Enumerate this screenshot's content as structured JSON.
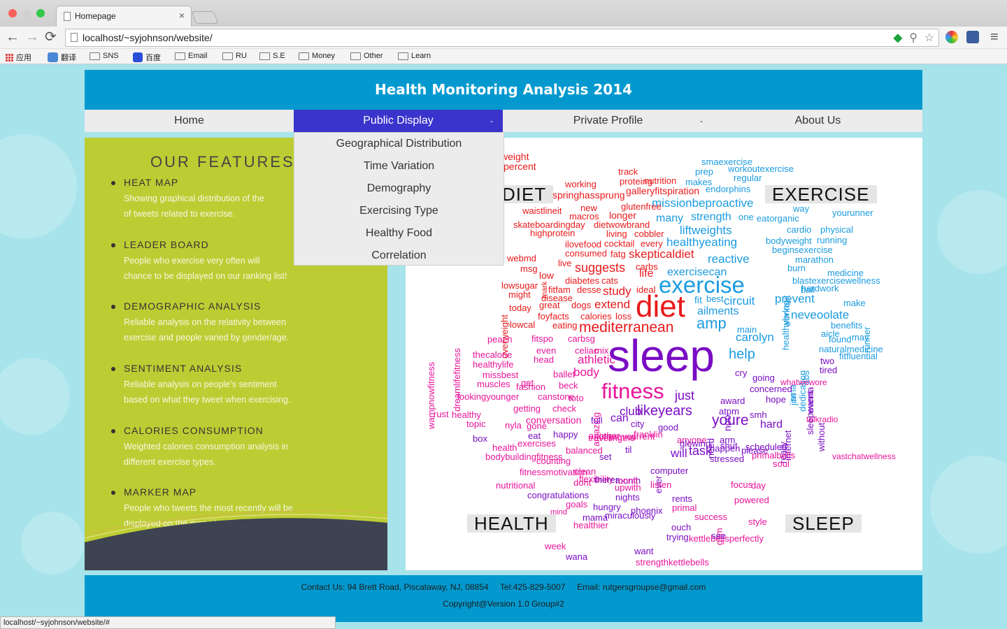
{
  "browser": {
    "tab_title": "Homepage",
    "tab_close": "×",
    "url": "localhost/~syjohnson/website/",
    "back": "←",
    "forward": "→",
    "reload": "⟳",
    "menu": "≡",
    "bookmarks": [
      "应用",
      "翻译",
      "SNS",
      "百度",
      "Email",
      "RU",
      "S.E",
      "Money",
      "Other",
      "Learn"
    ]
  },
  "site": {
    "title": "Health Monitoring Analysis 2014",
    "nav": [
      {
        "label": "Home"
      },
      {
        "label": "Public Display",
        "dash": "-"
      },
      {
        "label": "Private Profile",
        "dash": "-"
      },
      {
        "label": "About Us"
      }
    ],
    "dropdown": [
      "Geographical Distribution",
      "Time Variation",
      "Demography",
      "Exercising Type",
      "Healthy Food",
      "Correlation"
    ],
    "features_title": "OUR FEATURES",
    "features": [
      {
        "heading": "HEAT MAP",
        "lines": [
          "Showing graphical distribution of the",
          "of tweets related to exercise."
        ]
      },
      {
        "heading": "LEADER BOARD",
        "lines": [
          "People who exercise very often will",
          "chance to be displayed on our ranking list!"
        ]
      },
      {
        "heading": "DEMOGRAPHIC ANALYSIS",
        "lines": [
          "Reliable analysis on the relativity between",
          "exercise and people varied by gender/age."
        ]
      },
      {
        "heading": "SENTIMENT ANALYSIS",
        "lines": [
          "Reliable analysis on people’s sentiment",
          "based on what they tweet when exercising."
        ]
      },
      {
        "heading": "CALORIES CONSUMPTION",
        "lines": [
          "Weighted calories consumption analysis in",
          "different exercise types."
        ]
      },
      {
        "heading": "MARKER MAP",
        "lines": [
          "People who tweets the most recently will be",
          "displayed on the map identified by a marker."
        ]
      }
    ],
    "corner_labels": {
      "diet": "DIET",
      "exercise": "EXERCISE",
      "health": "HEALTH",
      "sleep": "SLEEP"
    },
    "footer": {
      "line1": "Contact Us: 94 Brett Road, Piscataway, NJ, 08854     Tel:425-829-5007     Email: rutgersgroupse@gmail.com",
      "line2": "Copyright@Version 1.0 Group#2"
    }
  },
  "status_bar": "localhost/~syjohnson/website/#",
  "colors": {
    "banner": "#0399cf",
    "nav_active": "#3a34cc",
    "features_bg": "#bccd34",
    "page_bg": "#a7e3ea",
    "diet_red": "#e8191b",
    "exercise_blue": "#1b9be0",
    "sleep_purple": "#7a0cc4",
    "health_pink": "#e8149a"
  },
  "wordcloud": [
    {
      "t": "weight",
      "c": "#e8191b"
    },
    {
      "t": "percent",
      "c": "#e8191b"
    },
    {
      "t": "smaexercise",
      "c": "#1b9be0"
    },
    {
      "t": "prep",
      "c": "#1b9be0"
    },
    {
      "t": "workoutexercise",
      "c": "#1b9be0"
    },
    {
      "t": "track",
      "c": "#e8191b"
    },
    {
      "t": "proteing",
      "c": "#e8191b"
    },
    {
      "t": "nutrition",
      "c": "#e8191b"
    },
    {
      "t": "makes",
      "c": "#1b9be0"
    },
    {
      "t": "regular",
      "c": "#1b9be0"
    },
    {
      "t": "working",
      "c": "#e8191b"
    },
    {
      "t": "springhassprung",
      "c": "#e8191b"
    },
    {
      "t": "galleryfitspiration",
      "c": "#e8191b"
    },
    {
      "t": "endorphins",
      "c": "#1b9be0"
    },
    {
      "t": "missionbeproactive",
      "c": "#1b9be0"
    },
    {
      "t": "way",
      "c": "#1b9be0"
    },
    {
      "t": "yourunner",
      "c": "#1b9be0"
    },
    {
      "t": "waistlineit",
      "c": "#e8191b"
    },
    {
      "t": "new",
      "c": "#e8191b"
    },
    {
      "t": "glutenfree",
      "c": "#e8191b"
    },
    {
      "t": "macros",
      "c": "#e8191b"
    },
    {
      "t": "longer",
      "c": "#e8191b"
    },
    {
      "t": "many",
      "c": "#1b9be0"
    },
    {
      "t": "strength",
      "c": "#1b9be0"
    },
    {
      "t": "one",
      "c": "#1b9be0"
    },
    {
      "t": "eatorganic",
      "c": "#1b9be0"
    },
    {
      "t": "skateboardingday",
      "c": "#e8191b"
    },
    {
      "t": "dietwowbrand",
      "c": "#e8191b"
    },
    {
      "t": "liftweights",
      "c": "#1b9be0"
    },
    {
      "t": "cardio",
      "c": "#1b9be0"
    },
    {
      "t": "physical",
      "c": "#1b9be0"
    },
    {
      "t": "highprotein",
      "c": "#e8191b"
    },
    {
      "t": "living",
      "c": "#e8191b"
    },
    {
      "t": "cobbler",
      "c": "#e8191b"
    },
    {
      "t": "healthyeating",
      "c": "#1b9be0"
    },
    {
      "t": "bodyweight",
      "c": "#1b9be0"
    },
    {
      "t": "running",
      "c": "#1b9be0"
    },
    {
      "t": "ilovefood",
      "c": "#e8191b"
    },
    {
      "t": "cocktail",
      "c": "#e8191b"
    },
    {
      "t": "every",
      "c": "#e8191b"
    },
    {
      "t": "beginsexercise",
      "c": "#1b9be0"
    },
    {
      "t": "webmd",
      "c": "#e8191b"
    },
    {
      "t": "mark",
      "c": "#e8191b"
    },
    {
      "t": "consumed",
      "c": "#e8191b"
    },
    {
      "t": "fatg",
      "c": "#e8191b"
    },
    {
      "t": "skepticaldiet",
      "c": "#e8191b"
    },
    {
      "t": "reactive",
      "c": "#1b9be0"
    },
    {
      "t": "marathon",
      "c": "#1b9be0"
    },
    {
      "t": "msg",
      "c": "#e8191b"
    },
    {
      "t": "live",
      "c": "#e8191b"
    },
    {
      "t": "suggests",
      "c": "#e8191b"
    },
    {
      "t": "carbs",
      "c": "#e8191b"
    },
    {
      "t": "exercisecan",
      "c": "#1b9be0"
    },
    {
      "t": "burn",
      "c": "#1b9be0"
    },
    {
      "t": "medicine",
      "c": "#1b9be0"
    },
    {
      "t": "low",
      "c": "#e8191b"
    },
    {
      "t": "life",
      "c": "#e8191b"
    },
    {
      "t": "healthyliving",
      "c": "#1b9be0"
    },
    {
      "t": "workout",
      "c": "#1b9be0"
    },
    {
      "t": "blastexercisewellness",
      "c": "#1b9be0"
    },
    {
      "t": "diabetes",
      "c": "#e8191b"
    },
    {
      "t": "cats",
      "c": "#e8191b"
    },
    {
      "t": "exercise",
      "c": "#1b9be0"
    },
    {
      "t": "lowsugar",
      "c": "#e8191b"
    },
    {
      "t": "fitfam",
      "c": "#e8191b"
    },
    {
      "t": "desse",
      "c": "#e8191b"
    },
    {
      "t": "study",
      "c": "#e8191b"
    },
    {
      "t": "ideal",
      "c": "#e8191b"
    },
    {
      "t": "ball",
      "c": "#1b9be0"
    },
    {
      "t": "hardwork",
      "c": "#1b9be0"
    },
    {
      "t": "might",
      "c": "#e8191b"
    },
    {
      "t": "disease",
      "c": "#e8191b"
    },
    {
      "t": "fit",
      "c": "#1b9be0"
    },
    {
      "t": "best",
      "c": "#1b9be0"
    },
    {
      "t": "circuit",
      "c": "#1b9be0"
    },
    {
      "t": "prevent",
      "c": "#1b9be0"
    },
    {
      "t": "make",
      "c": "#1b9be0"
    },
    {
      "t": "overweight",
      "c": "#e8191b"
    },
    {
      "t": "great",
      "c": "#e8191b"
    },
    {
      "t": "dogs",
      "c": "#e8191b"
    },
    {
      "t": "extend",
      "c": "#e8191b"
    },
    {
      "t": "diet",
      "c": "#e8191b"
    },
    {
      "t": "ailments",
      "c": "#1b9be0"
    },
    {
      "t": "runner",
      "c": "#1b9be0"
    },
    {
      "t": "today",
      "c": "#e8191b"
    },
    {
      "t": "foyfacts",
      "c": "#e8191b"
    },
    {
      "t": "calories",
      "c": "#e8191b"
    },
    {
      "t": "loss",
      "c": "#e8191b"
    },
    {
      "t": "neveoolate",
      "c": "#1b9be0"
    },
    {
      "t": "lowcal",
      "c": "#e8191b"
    },
    {
      "t": "eating",
      "c": "#e8191b"
    },
    {
      "t": "amp",
      "c": "#1b9be0"
    },
    {
      "t": "benefits",
      "c": "#1b9be0"
    },
    {
      "t": "mediterranean",
      "c": "#e8191b"
    },
    {
      "t": "main",
      "c": "#1b9be0"
    },
    {
      "t": "aicle",
      "c": "#1b9be0"
    },
    {
      "t": "carolyn",
      "c": "#1b9be0"
    },
    {
      "t": "abs",
      "c": "#1b9be0"
    },
    {
      "t": "found",
      "c": "#1b9be0"
    },
    {
      "t": "may",
      "c": "#1b9be0"
    },
    {
      "t": "peach",
      "c": "#e8149a"
    },
    {
      "t": "fitspo",
      "c": "#e8149a"
    },
    {
      "t": "carbsg",
      "c": "#e8149a"
    },
    {
      "t": "dedication",
      "c": "#1b9be0"
    },
    {
      "t": "naturalmedicine",
      "c": "#1b9be0"
    },
    {
      "t": "even",
      "c": "#e8149a"
    },
    {
      "t": "celiac",
      "c": "#e8149a"
    },
    {
      "t": "mix",
      "c": "#e8149a"
    },
    {
      "t": "fitfluential",
      "c": "#1b9be0"
    },
    {
      "t": "thecalorie",
      "c": "#e8149a"
    },
    {
      "t": "help",
      "c": "#1b9be0"
    },
    {
      "t": "jim",
      "c": "#1b9be0"
    },
    {
      "t": "two",
      "c": "#7a0cc4"
    },
    {
      "t": "wampnowfitness",
      "c": "#e8149a"
    },
    {
      "t": "dreamlifefitness",
      "c": "#e8149a"
    },
    {
      "t": "head",
      "c": "#e8149a"
    },
    {
      "t": "athletic",
      "c": "#e8149a"
    },
    {
      "t": "sleep",
      "c": "#7a0cc4"
    },
    {
      "t": "sma",
      "c": "#1b9be0"
    },
    {
      "t": "wanna",
      "c": "#7a0cc4"
    },
    {
      "t": "tired",
      "c": "#7a0cc4"
    },
    {
      "t": "healthylife",
      "c": "#e8149a"
    },
    {
      "t": "body",
      "c": "#e8149a"
    },
    {
      "t": "missbest",
      "c": "#e8149a"
    },
    {
      "t": "ballet",
      "c": "#e8149a"
    },
    {
      "t": "cry",
      "c": "#7a0cc4"
    },
    {
      "t": "going",
      "c": "#7a0cc4"
    },
    {
      "t": "get",
      "c": "#e8149a"
    },
    {
      "t": "muscles",
      "c": "#e8149a"
    },
    {
      "t": "fashion",
      "c": "#e8149a"
    },
    {
      "t": "beck",
      "c": "#e8149a"
    },
    {
      "t": "concerned",
      "c": "#7a0cc4"
    },
    {
      "t": "fitness",
      "c": "#e8149a"
    },
    {
      "t": "noo",
      "c": "#7a0cc4"
    },
    {
      "t": "sleepevent",
      "c": "#7a0cc4"
    },
    {
      "t": "lookingyounger",
      "c": "#e8149a"
    },
    {
      "t": "canstone",
      "c": "#e8149a"
    },
    {
      "t": "toto",
      "c": "#e8149a"
    },
    {
      "t": "just",
      "c": "#7a0cc4"
    },
    {
      "t": "award",
      "c": "#7a0cc4"
    },
    {
      "t": "hope",
      "c": "#7a0cc4"
    },
    {
      "t": "without",
      "c": "#7a0cc4"
    },
    {
      "t": "getting",
      "c": "#e8149a"
    },
    {
      "t": "check",
      "c": "#e8149a"
    },
    {
      "t": "amazing",
      "c": "#e8149a"
    },
    {
      "t": "club",
      "c": "#7a0cc4"
    },
    {
      "t": "likeyears",
      "c": "#7a0cc4"
    },
    {
      "t": "atpm",
      "c": "#7a0cc4"
    },
    {
      "t": "internet",
      "c": "#7a0cc4"
    },
    {
      "t": "healthy",
      "c": "#e8149a"
    },
    {
      "t": "rust",
      "c": "#e8149a"
    },
    {
      "t": "need",
      "c": "#7a0cc4"
    },
    {
      "t": "smh",
      "c": "#7a0cc4"
    },
    {
      "t": "really",
      "c": "#7a0cc4"
    },
    {
      "t": "conversation",
      "c": "#e8149a"
    },
    {
      "t": "full",
      "c": "#7a0cc4"
    },
    {
      "t": "can",
      "c": "#7a0cc4"
    },
    {
      "t": "youre",
      "c": "#7a0cc4"
    },
    {
      "t": "topic",
      "c": "#e8149a"
    },
    {
      "t": "nyla",
      "c": "#e8149a"
    },
    {
      "t": "gone",
      "c": "#e8149a"
    },
    {
      "t": "city",
      "c": "#7a0cc4"
    },
    {
      "t": "good",
      "c": "#7a0cc4"
    },
    {
      "t": "hard",
      "c": "#7a0cc4"
    },
    {
      "t": "another",
      "c": "#e8149a"
    },
    {
      "t": "eat",
      "c": "#7a0cc4"
    },
    {
      "t": "travelingthe",
      "c": "#e8149a"
    },
    {
      "t": "current",
      "c": "#e8149a"
    },
    {
      "t": "anyone",
      "c": "#e8149a"
    },
    {
      "t": "arm",
      "c": "#7a0cc4"
    },
    {
      "t": "box",
      "c": "#7a0cc4"
    },
    {
      "t": "happy",
      "c": "#7a0cc4"
    },
    {
      "t": "improves",
      "c": "#e8149a"
    },
    {
      "t": "franklin",
      "c": "#e8149a"
    },
    {
      "t": "shut",
      "c": "#7a0cc4"
    },
    {
      "t": "scheduled",
      "c": "#7a0cc4"
    },
    {
      "t": "health",
      "c": "#e8149a"
    },
    {
      "t": "exercises",
      "c": "#e8149a"
    },
    {
      "t": "balanced",
      "c": "#e8149a"
    },
    {
      "t": "til",
      "c": "#7a0cc4"
    },
    {
      "t": "will",
      "c": "#7a0cc4"
    },
    {
      "t": "task",
      "c": "#7a0cc4"
    },
    {
      "t": "happen",
      "c": "#7a0cc4"
    },
    {
      "t": "please",
      "c": "#7a0cc4"
    },
    {
      "t": "primalbells",
      "c": "#e8149a"
    },
    {
      "t": "bodybuildingfitness",
      "c": "#e8149a"
    },
    {
      "t": "counting",
      "c": "#e8149a"
    },
    {
      "t": "set",
      "c": "#7a0cc4"
    },
    {
      "t": "ever",
      "c": "#7a0cc4"
    },
    {
      "t": "glowing",
      "c": "#7a0cc4"
    },
    {
      "t": "stressed",
      "c": "#7a0cc4"
    },
    {
      "t": "soul",
      "c": "#e8149a"
    },
    {
      "t": "fitnessmotivation",
      "c": "#e8149a"
    },
    {
      "t": "clean",
      "c": "#e8149a"
    },
    {
      "t": "computer",
      "c": "#7a0cc4"
    },
    {
      "t": "nutritional",
      "c": "#e8149a"
    },
    {
      "t": "dont",
      "c": "#e8149a"
    },
    {
      "t": "month",
      "c": "#7a0cc4"
    },
    {
      "t": "flexibility",
      "c": "#e8149a"
    },
    {
      "t": "theres",
      "c": "#7a0cc4"
    },
    {
      "t": "upwith",
      "c": "#e8149a"
    },
    {
      "t": "onnit",
      "c": "#e8149a"
    },
    {
      "t": "listen",
      "c": "#e8149a"
    },
    {
      "t": "focus",
      "c": "#e8149a"
    },
    {
      "t": "day",
      "c": "#e8149a"
    },
    {
      "t": "congratulations",
      "c": "#7a0cc4"
    },
    {
      "t": "nights",
      "c": "#7a0cc4"
    },
    {
      "t": "rents",
      "c": "#7a0cc4"
    },
    {
      "t": "powered",
      "c": "#e8149a"
    },
    {
      "t": "goals",
      "c": "#e8149a"
    },
    {
      "t": "hungry",
      "c": "#7a0cc4"
    },
    {
      "t": "phoenix",
      "c": "#7a0cc4"
    },
    {
      "t": "primal",
      "c": "#e8149a"
    },
    {
      "t": "gym",
      "c": "#e8149a"
    },
    {
      "t": "mind",
      "c": "#e8149a"
    },
    {
      "t": "mama",
      "c": "#7a0cc4"
    },
    {
      "t": "miraculously",
      "c": "#7a0cc4"
    },
    {
      "t": "success",
      "c": "#e8149a"
    },
    {
      "t": "style",
      "c": "#e8149a"
    },
    {
      "t": "healthier",
      "c": "#e8149a"
    },
    {
      "t": "ouch",
      "c": "#7a0cc4"
    },
    {
      "t": "trying",
      "c": "#7a0cc4"
    },
    {
      "t": "kettlebellsperfectly",
      "c": "#e8149a"
    },
    {
      "t": "see",
      "c": "#7a0cc4"
    },
    {
      "t": "week",
      "c": "#e8149a"
    },
    {
      "t": "wana",
      "c": "#7a0cc4"
    },
    {
      "t": "want",
      "c": "#7a0cc4"
    },
    {
      "t": "strengthkettlebells",
      "c": "#e8149a"
    },
    {
      "t": "whatwewore",
      "c": "#e8149a"
    },
    {
      "t": "talkradio",
      "c": "#e8149a"
    },
    {
      "t": "vastchatwellness",
      "c": "#e8149a"
    }
  ]
}
